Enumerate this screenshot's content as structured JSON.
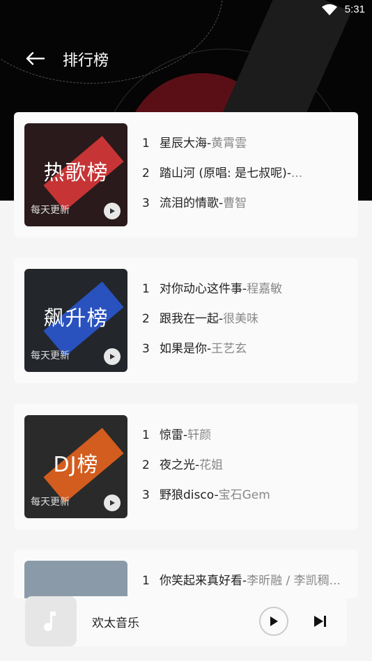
{
  "status": {
    "time": "5:31"
  },
  "header": {
    "title": "排行榜"
  },
  "charts": [
    {
      "cover_label": "热歌榜",
      "update_text": "每天更新",
      "band_color": "#e23a3a",
      "cover_bg": "#2a1a1c",
      "tracks": [
        {
          "num": "1",
          "title": "星辰大海",
          "artist": "黄霄雲"
        },
        {
          "num": "2",
          "title": "踏山河 (原唱: 是七叔呢)",
          "artist": "..."
        },
        {
          "num": "3",
          "title": "流泪的情歌",
          "artist": "曹智"
        }
      ]
    },
    {
      "cover_label": "飙升榜",
      "update_text": "每天更新",
      "band_color": "#2a5bd8",
      "cover_bg": "#23272c",
      "tracks": [
        {
          "num": "1",
          "title": "对你动心这件事",
          "artist": "程嘉敏"
        },
        {
          "num": "2",
          "title": "跟我在一起",
          "artist": "很美味"
        },
        {
          "num": "3",
          "title": "如果是你",
          "artist": "王艺玄"
        }
      ]
    },
    {
      "cover_label": "DJ榜",
      "update_text": "每天更新",
      "band_color": "#f0661c",
      "cover_bg": "#2a2a2a",
      "tracks": [
        {
          "num": "1",
          "title": "惊雷",
          "artist": "轩颜"
        },
        {
          "num": "2",
          "title": "夜之光",
          "artist": "花姐"
        },
        {
          "num": "3",
          "title": "野狼disco",
          "artist": "宝石Gem"
        }
      ]
    },
    {
      "cover_bg": "#8a9aa8",
      "tracks": [
        {
          "num": "1",
          "title": "你笑起来真好看",
          "artist": "李昕融 / 李凯稠..."
        }
      ]
    }
  ],
  "player": {
    "name": "欢太音乐"
  }
}
